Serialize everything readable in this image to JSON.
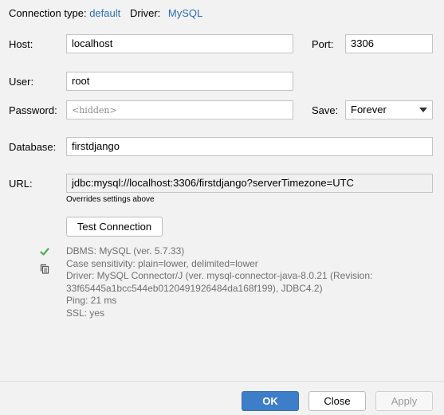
{
  "header": {
    "connection_type_label": "Connection type:",
    "connection_type_value": "default",
    "driver_label": "Driver:",
    "driver_value": "MySQL"
  },
  "form": {
    "host_label": "Host:",
    "host_value": "localhost",
    "port_label": "Port:",
    "port_value": "3306",
    "user_label": "User:",
    "user_value": "root",
    "password_label": "Password:",
    "password_placeholder": "<hidden>",
    "save_label": "Save:",
    "save_value": "Forever",
    "database_label": "Database:",
    "database_value": "firstdjango",
    "url_label": "URL:",
    "url_value": "jdbc:mysql://localhost:3306/firstdjango?serverTimezone=UTC",
    "url_hint": "Overrides settings above"
  },
  "test": {
    "button_label": "Test Connection",
    "status_icon": "check-icon",
    "copy_icon": "copy-icon",
    "status_color": "#4caf50",
    "lines": [
      "DBMS: MySQL (ver. 5.7.33)",
      "Case sensitivity: plain=lower, delimited=lower",
      "Driver: MySQL Connector/J (ver. mysql-connector-java-8.0.21 (Revision:",
      "33f65445a1bcc544eb0120491926484da168f199), JDBC4.2)",
      "Ping: 21 ms",
      "SSL: yes"
    ]
  },
  "footer": {
    "ok_label": "OK",
    "close_label": "Close",
    "apply_label": "Apply"
  }
}
